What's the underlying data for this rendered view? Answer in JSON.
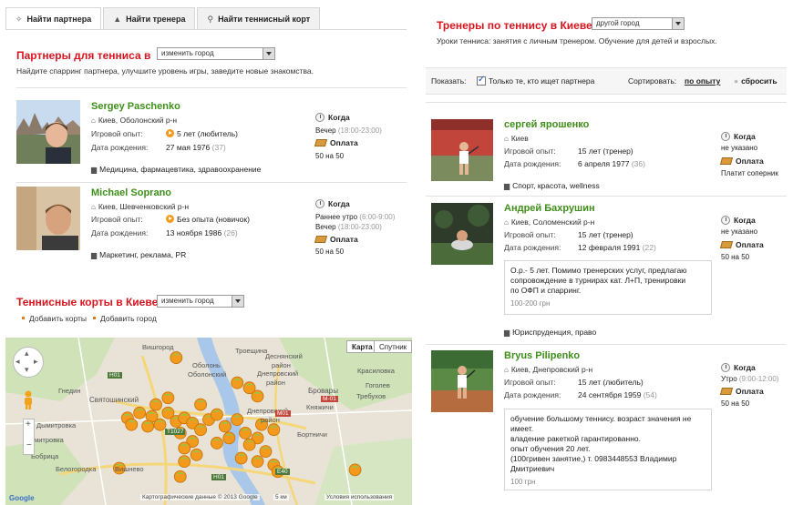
{
  "left": {
    "tabs": [
      {
        "icon": "pin-icon",
        "label": "Найти партнера",
        "active": true
      },
      {
        "icon": "user-icon",
        "label": "Найти тренера",
        "active": false
      },
      {
        "icon": "location-icon",
        "label": "Найти теннисный корт",
        "active": false
      }
    ],
    "title": "Партнеры для тенниса в",
    "city_select": "изменить город",
    "subtitle": "Найдите спарринг партнера, улучшите уровень игры, заведите новые знакомства.",
    "partners": [
      {
        "name": "Sergey Paschenko",
        "city": "Киев, Оболонский р-н",
        "exp_label": "Игровой опыт:",
        "exp_value": "5 лет (любитель)",
        "bday_label": "Дата рождения:",
        "bday_value": "27 мая 1976",
        "age": "(37)",
        "tags": "Медицина, фармацевтика, здравоохранение",
        "when_label": "Когда",
        "times": [
          {
            "name": "Вечер",
            "range": "(18:00-23:00)"
          }
        ],
        "pay_label": "Оплата",
        "pay_value": "50 на 50"
      },
      {
        "name": "Michael Soprano",
        "city": "Киев, Шевченковский р-н",
        "exp_label": "Игровой опыт:",
        "exp_value": "Без опыта (новичок)",
        "bday_label": "Дата рождения:",
        "bday_value": "13 ноября 1986",
        "age": "(26)",
        "tags": "Маркетинг, реклама, PR",
        "when_label": "Когда",
        "times": [
          {
            "name": "Раннее утро",
            "range": "(6:00-9:00)"
          },
          {
            "name": "Вечер",
            "range": "(18:00-23:00)"
          }
        ],
        "pay_label": "Оплата",
        "pay_value": "50 на 50"
      }
    ]
  },
  "map_panel": {
    "title": "Теннисные корты в Киеве",
    "city_select": "изменить город",
    "links": [
      "Добавить корты",
      "Добавить город"
    ],
    "map_buttons": [
      "Карта",
      "Спутник"
    ],
    "attribution": "Картографические данные © 2013 Google",
    "scale": "5 км",
    "terms": "Условия использования",
    "district_labels": [
      "Оболонь",
      "Оболонский",
      "Деснянский",
      "район",
      "Днепровский",
      "район",
      "Бровары",
      "Вишгород",
      "Святошинский",
      "Днепровский",
      "район",
      "Троещина",
      "Красиловка",
      "Княжичи",
      "Гоголев",
      "Требухов",
      "Дымитровка",
      "Бобрица",
      "Белогородка",
      "Вишнево",
      "Бортничи",
      "Гнедин",
      "Дмитровка"
    ],
    "road_labels": [
      "H01",
      "M-01",
      "M01",
      "H01",
      "E40",
      "T1027"
    ],
    "markers": [
      {
        "x": 42,
        "y": 12
      },
      {
        "x": 57,
        "y": 27
      },
      {
        "x": 62,
        "y": 35
      },
      {
        "x": 60,
        "y": 30
      },
      {
        "x": 37,
        "y": 40
      },
      {
        "x": 33,
        "y": 45
      },
      {
        "x": 30,
        "y": 48
      },
      {
        "x": 36,
        "y": 47
      },
      {
        "x": 40,
        "y": 45
      },
      {
        "x": 38,
        "y": 52
      },
      {
        "x": 42,
        "y": 50
      },
      {
        "x": 44,
        "y": 48
      },
      {
        "x": 46,
        "y": 51
      },
      {
        "x": 48,
        "y": 55
      },
      {
        "x": 43,
        "y": 57
      },
      {
        "x": 35,
        "y": 53
      },
      {
        "x": 50,
        "y": 49
      },
      {
        "x": 52,
        "y": 46
      },
      {
        "x": 54,
        "y": 53
      },
      {
        "x": 57,
        "y": 49
      },
      {
        "x": 59,
        "y": 57
      },
      {
        "x": 63,
        "y": 52
      },
      {
        "x": 66,
        "y": 55
      },
      {
        "x": 62,
        "y": 60
      },
      {
        "x": 46,
        "y": 62
      },
      {
        "x": 44,
        "y": 66
      },
      {
        "x": 52,
        "y": 63
      },
      {
        "x": 55,
        "y": 60
      },
      {
        "x": 60,
        "y": 64
      },
      {
        "x": 64,
        "y": 68
      },
      {
        "x": 47,
        "y": 70
      },
      {
        "x": 58,
        "y": 72
      },
      {
        "x": 62,
        "y": 74
      },
      {
        "x": 66,
        "y": 76
      },
      {
        "x": 28,
        "y": 78
      },
      {
        "x": 43,
        "y": 83
      },
      {
        "x": 86,
        "y": 79
      },
      {
        "x": 67,
        "y": 80
      },
      {
        "x": 40,
        "y": 36
      },
      {
        "x": 48,
        "y": 40
      },
      {
        "x": 44,
        "y": 74
      },
      {
        "x": 31,
        "y": 52
      }
    ]
  },
  "right": {
    "title": "Тренеры по теннису в Киеве",
    "city_select": "другой город",
    "subtitle": "Уроки тенниса: занятия с личным тренером. Обучение для детей и взрослых.",
    "show_label": "Показать:",
    "filter_label": "Только те, кто ищет партнера",
    "sort_label": "Сортировать:",
    "sort_value": "по опыту",
    "reset_label": "сбросить",
    "trainers": [
      {
        "name": "сергей ярошенко",
        "city": "Киев",
        "exp_label": "Игровой опыт:",
        "exp_value": "15 лет (тренер)",
        "bday_label": "Дата рождения:",
        "bday_value": "6 апреля 1977",
        "age": "(36)",
        "tags": "Спорт, красота, wellness",
        "when_label": "Когда",
        "when_value": "не указано",
        "pay_label": "Оплата",
        "pay_value": "Платит соперник",
        "desc": [],
        "price": ""
      },
      {
        "name": "Андрей Бахрушин",
        "city": "Киев, Соломенский р-н",
        "exp_label": "Игровой опыт:",
        "exp_value": "15 лет (тренер)",
        "bday_label": "Дата рождения:",
        "bday_value": "12 февраля 1991",
        "age": "(22)",
        "tags": "Юриспруденция, право",
        "when_label": "Когда",
        "when_value": "не указано",
        "pay_label": "Оплата",
        "pay_value": "50 на 50",
        "desc": [
          "О.р.- 5 лет. Помимо тренерских услуг, предлагаю",
          "сопровождение в турнирах кат. Л+П, тренировки",
          "по ОФП и спарринг."
        ],
        "price": "100-200 грн"
      },
      {
        "name": "Bryus Pilipenko",
        "city": "Киев, Днепровский р-н",
        "exp_label": "Игровой опыт:",
        "exp_value": "15 лет (любитель)",
        "bday_label": "Дата рождения:",
        "bday_value": "24 сентября 1959",
        "age": "(54)",
        "tags": "",
        "when_label": "Когда",
        "when_value": "Утро",
        "when_range": "(9:00-12:00)",
        "pay_label": "Оплата",
        "pay_value": "50 на 50",
        "desc": [
          "обучение большому теннису. возраст значения не",
          "имеет.",
          "владение ракеткой гарантированно.",
          "опыт обучения 20 лет.",
          "(100гривен занятие,) т. 0983448553 Владимир",
          "Дмитриевич"
        ],
        "price": "100 грн"
      }
    ]
  },
  "colors": {
    "accent_red": "#d8151f",
    "name_green": "#3f8f1a",
    "marker_orange": "#f39a1c"
  }
}
